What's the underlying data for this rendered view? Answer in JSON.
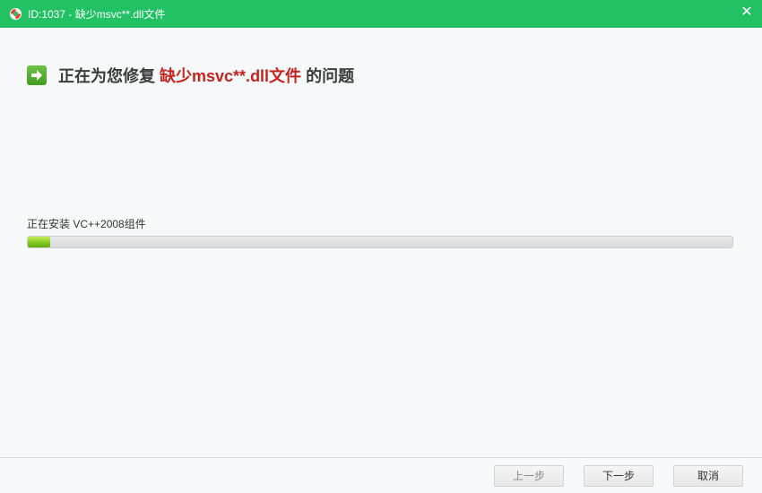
{
  "window": {
    "title": "ID:1037 - 缺少msvc**.dll文件",
    "close_glyph": "✕",
    "accent_color": "#22c164"
  },
  "heading": {
    "prefix": "正在为您修复",
    "problem": "缺少msvc**.dll文件",
    "suffix": "的问题",
    "problem_color": "#c5231c"
  },
  "progress": {
    "status": "正在安装 VC++2008组件",
    "fraction": 0.032
  },
  "buttons": {
    "prev": "上一步",
    "next": "下一步",
    "cancel": "取消"
  },
  "icons": {
    "app": "lifebuoy-icon",
    "heading": "arrow-right-icon",
    "close": "close-icon"
  }
}
